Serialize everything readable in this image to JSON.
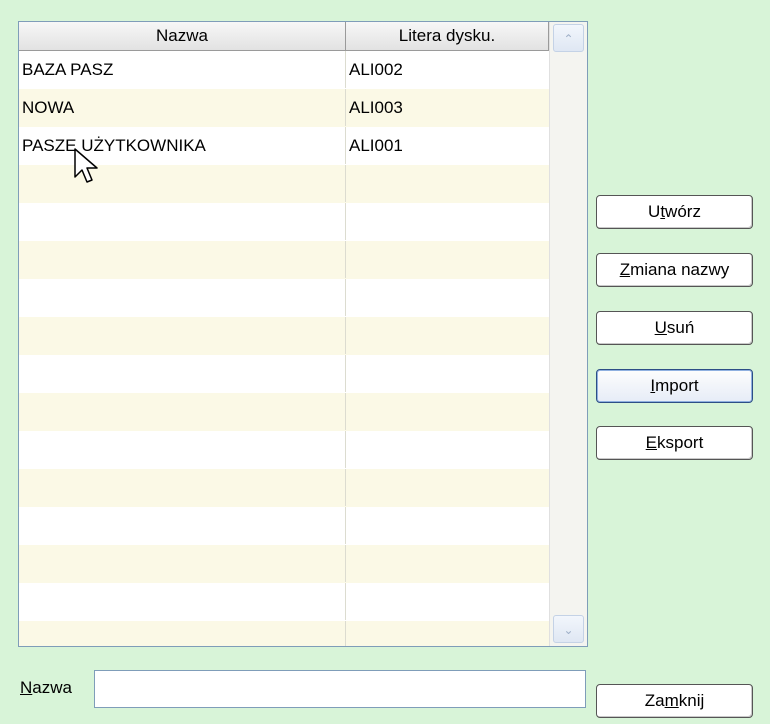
{
  "grid": {
    "columns": [
      "Nazwa",
      "Litera dysku."
    ],
    "rows": [
      {
        "nazwa": "BAZA PASZ",
        "litera": "ALI002"
      },
      {
        "nazwa": "NOWA",
        "litera": "ALI003"
      },
      {
        "nazwa": "PASZE UŻYTKOWNIKA",
        "litera": "ALI001"
      }
    ],
    "empty_row_count": 13
  },
  "buttons": {
    "utworz": {
      "pre": "U",
      "acc": "t",
      "post": "wórz"
    },
    "zmiana": {
      "pre": "",
      "acc": "Z",
      "post": "miana nazwy"
    },
    "usun": {
      "pre": "",
      "acc": "U",
      "post": "suń"
    },
    "import": {
      "pre": "",
      "acc": "I",
      "post": "mport"
    },
    "eksport": {
      "pre": "",
      "acc": "E",
      "post": "ksport"
    },
    "zamknij": {
      "pre": "Za",
      "acc": "m",
      "post": "knij"
    }
  },
  "name_field": {
    "label_acc": "N",
    "label_rest": "azwa",
    "value": ""
  },
  "scroll": {
    "up_glyph": "⌃",
    "down_glyph": "⌄"
  }
}
